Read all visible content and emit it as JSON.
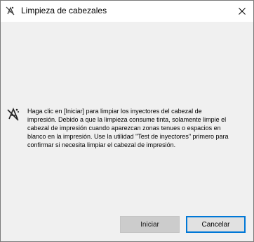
{
  "window": {
    "title": "Limpieza de cabezales",
    "title_icon": "printer-head-icon",
    "close_icon": "close-icon"
  },
  "content": {
    "icon": "printhead-nozzle-icon",
    "message": "Haga clic en [Iniciar] para limpiar los inyectores del cabezal de impresión. Debido a que la limpieza consume tinta, solamente limpie el cabezal de impresión cuando aparezcan zonas tenues o espacios en blanco en la impresión. Use la utilidad \"Test de inyectores\" primero para confirmar si necesita limpiar el cabezal de impresión."
  },
  "buttons": {
    "start_label": "Iniciar",
    "cancel_label": "Cancelar"
  },
  "colors": {
    "dialog_background": "#f0f0f0",
    "focus_border": "#0078d7"
  }
}
